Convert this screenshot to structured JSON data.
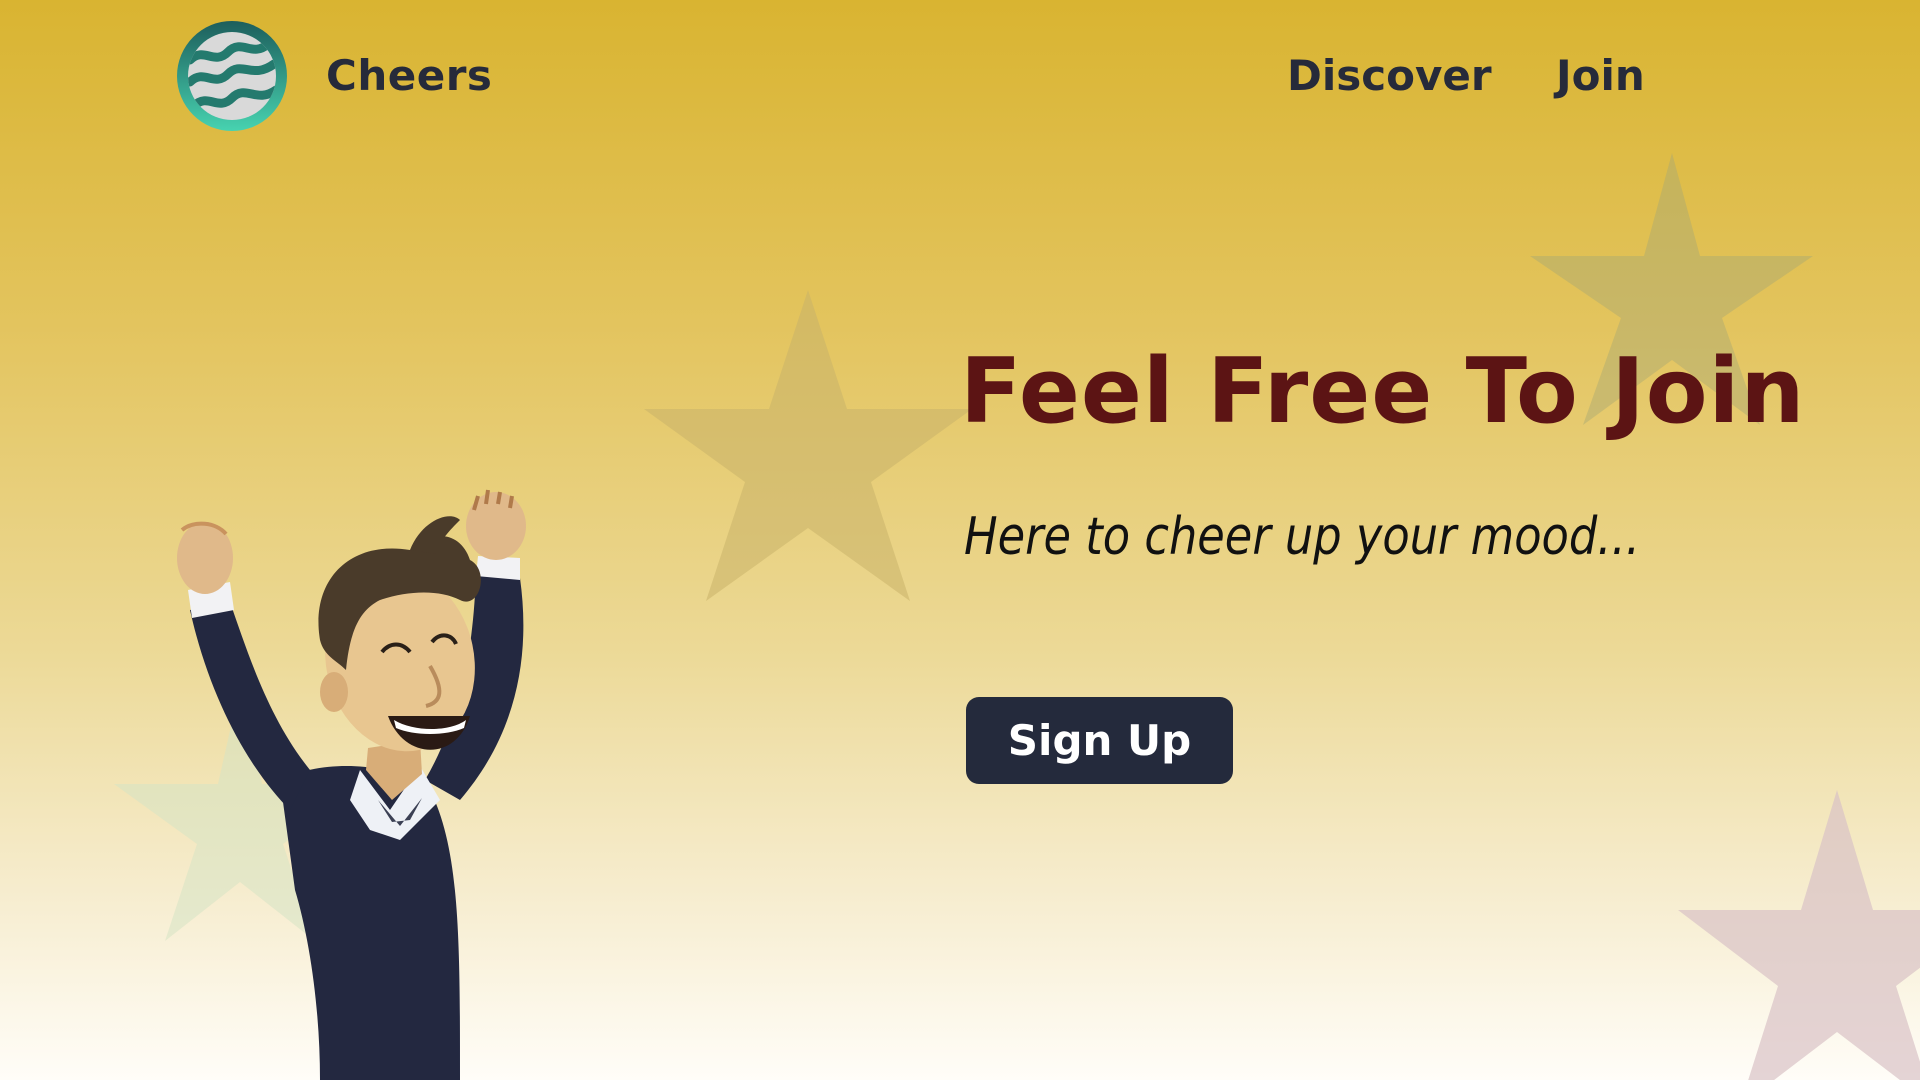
{
  "header": {
    "logo_icon": "wave-circle-logo-icon",
    "brand_name": "Cheers",
    "nav": [
      {
        "label": "Discover"
      },
      {
        "label": "Join"
      }
    ]
  },
  "hero": {
    "title": "Feel Free To Join",
    "subtitle": "Here to cheer up your mood...",
    "cta_label": "Sign Up"
  },
  "illustration": "cheering-man-illustration",
  "decorations": [
    "star-icon",
    "star-icon",
    "star-icon",
    "star-icon"
  ],
  "colors": {
    "background_top": "#d9b431",
    "background_bottom": "#fffdf8",
    "title": "#5c1414",
    "nav_text": "#262a3a",
    "button_bg": "#242a3c",
    "button_text": "#ffffff",
    "logo_ring": "#1f6f6a"
  }
}
